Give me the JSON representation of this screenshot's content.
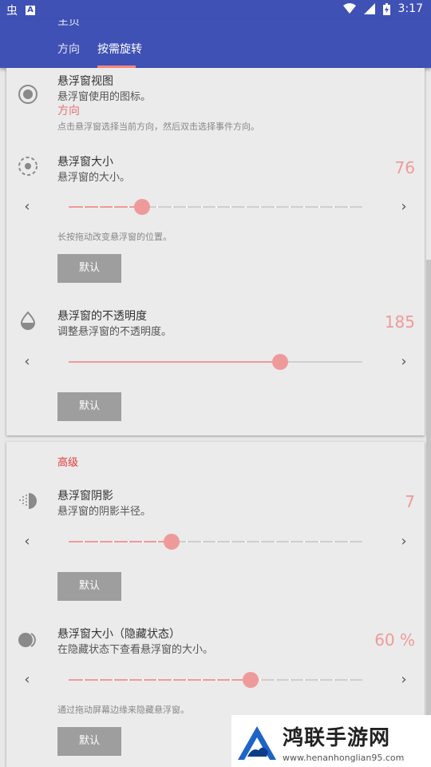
{
  "statusbar": {
    "time": "3:17",
    "left_glyph_1": "虫",
    "left_glyph_2": "A"
  },
  "appbar": {
    "title_partial": "主页"
  },
  "tabs": [
    {
      "label": "方向"
    },
    {
      "label": "按需旋转"
    }
  ],
  "card1": {
    "floating_view": {
      "title": "悬浮窗视图",
      "subtitle": "悬浮窗使用的图标。",
      "value": "方向",
      "note": "点击悬浮窗选择当前方向，然后双击选择事件方向。"
    },
    "size": {
      "title": "悬浮窗大小",
      "subtitle": "悬浮窗的大小。",
      "value": "76",
      "slider_percent": 25,
      "note": "长按拖动改变悬浮窗的位置。",
      "default_button": "默认"
    },
    "opacity": {
      "title": "悬浮窗的不透明度",
      "subtitle": "调整悬浮窗的不透明度。",
      "value": "185",
      "slider_percent": 72,
      "default_button": "默认"
    }
  },
  "card2": {
    "section_title": "高级",
    "shadow": {
      "title": "悬浮窗阴影",
      "subtitle": "悬浮窗的阴影半径。",
      "value": "7",
      "slider_percent": 35,
      "default_button": "默认"
    },
    "hidden_size": {
      "title": "悬浮窗大小（隐藏状态）",
      "subtitle": "在隐藏状态下查看悬浮窗的大小。",
      "value": "60 %",
      "slider_percent": 62,
      "note": "通过拖动屏幕边缘来隐藏悬浮窗。",
      "default_button": "默认"
    }
  },
  "watermark": {
    "main": "鸿联手游网",
    "sub": "www.henanhonglian95.com"
  },
  "colors": {
    "primary": "#3f51b5",
    "accent": "#ef9a9a",
    "button": "#9e9e9e"
  }
}
